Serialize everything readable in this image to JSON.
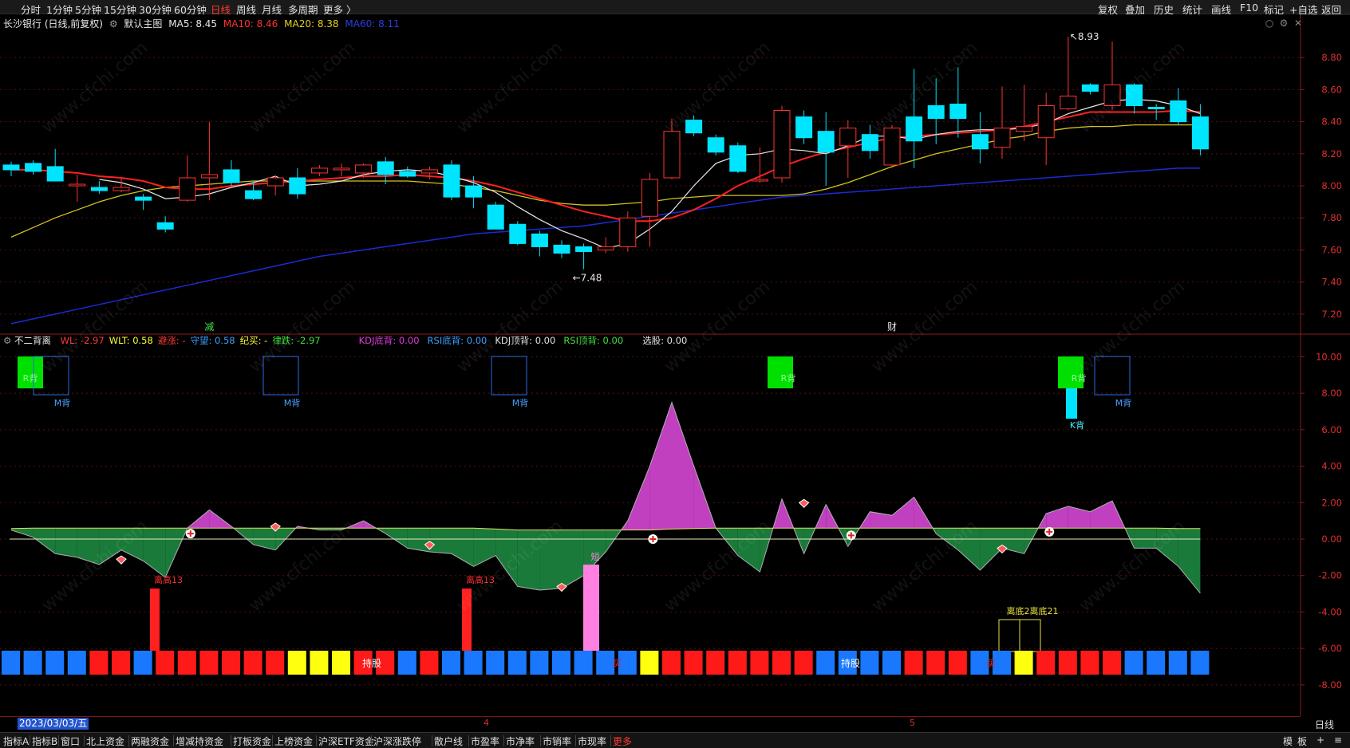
{
  "toolbar": {
    "periods": [
      "分时",
      "1分钟",
      "5分钟",
      "15分钟",
      "30分钟",
      "60分钟",
      "日线",
      "周线",
      "月线",
      "多周期",
      "更多 〉"
    ],
    "active_period": "日线",
    "right_items": [
      "复权",
      "叠加",
      "历史",
      "统计",
      "画线",
      "F10",
      "标记",
      "+自选",
      "返回"
    ]
  },
  "main_legend": {
    "security": "长沙银行 (日线,前复权)",
    "template": "默认主图",
    "ma5": "MA5: 8.45",
    "ma10": "MA10: 8.46",
    "ma20": "MA20: 8.38",
    "ma60": "MA60: 8.11"
  },
  "indicator_legend": {
    "name": "不二背离",
    "items": [
      {
        "text": "WL: -2.97",
        "color": "#ff3b3b"
      },
      {
        "text": "WLT: 0.58",
        "color": "#ffff30"
      },
      {
        "text": "避涨: -",
        "color": "#ff3b3b"
      },
      {
        "text": "守望: 0.58",
        "color": "#3aa0ff"
      },
      {
        "text": "纪买: -",
        "color": "#ffff30"
      },
      {
        "text": "律跌: -2.97",
        "color": "#40e040"
      },
      {
        "text": "KDJ底背: 0.00",
        "color": "#e040e0"
      },
      {
        "text": "RSI底背: 0.00",
        "color": "#3aa0ff"
      },
      {
        "text": "KDJ顶背: 0.00",
        "color": "#e0e0e0"
      },
      {
        "text": "RSI顶背: 0.00",
        "color": "#40e040"
      },
      {
        "text": "选股: 0.00",
        "color": "#e0e0e0"
      }
    ]
  },
  "price_axis": [
    "8.80",
    "8.60",
    "8.40",
    "8.20",
    "8.00",
    "7.80",
    "7.60",
    "7.40",
    "7.20"
  ],
  "ind_axis": [
    "10.00",
    "8.00",
    "6.00",
    "4.00",
    "2.00",
    "0.00",
    "-2.00",
    "-4.00",
    "-6.00",
    "-8.00"
  ],
  "annotations": {
    "high": "8.93",
    "low": "7.48",
    "event_a": "减",
    "event_b": "财",
    "r_back": "R背",
    "m_back": "M背",
    "k_back": "K背",
    "lili13": "离高13",
    "short": "短",
    "lidi21": "离底2离底21",
    "hold": "持股",
    "buy": "买"
  },
  "date_bar": {
    "cursor_date": "2023/03/03/五",
    "month_4": "4",
    "month_5": "5",
    "period_label": "日线"
  },
  "bottom_bar": {
    "items": [
      "指标A",
      "指标B",
      "窗口",
      "北上资金",
      "两融资金",
      "增减持资金",
      "打板资金",
      "上榜资金",
      "沪深ETF资金",
      "沪深涨跌停",
      "散户线",
      "市盈率",
      "市净率",
      "市销率",
      "市现率",
      "更多"
    ],
    "right": [
      "模",
      "板",
      "+",
      "≡"
    ]
  },
  "colors": {
    "up": "#ff3232",
    "down": "#00e5ff",
    "ma5": "#e8e8e8",
    "ma10": "#ff2020",
    "ma20": "#d4c21c",
    "ma60": "#1c2ad4",
    "magenta": "#c040c0",
    "green": "#1a7a3a"
  },
  "chart_data": {
    "type": "candlestick",
    "candles": [
      [
        8.13,
        8.1,
        8.15,
        8.06
      ],
      [
        8.14,
        8.09,
        8.16,
        8.07
      ],
      [
        8.12,
        8.03,
        8.23,
        8.03
      ],
      [
        8.0,
        8.01,
        8.07,
        7.9
      ],
      [
        7.99,
        7.97,
        8.03,
        7.95
      ],
      [
        7.97,
        7.99,
        8.05,
        7.96
      ],
      [
        7.93,
        7.91,
        7.95,
        7.85
      ],
      [
        7.77,
        7.73,
        7.81,
        7.71
      ],
      [
        7.91,
        8.05,
        8.19,
        7.9
      ],
      [
        8.05,
        8.07,
        8.4,
        7.91
      ],
      [
        8.1,
        8.02,
        8.16,
        8.0
      ],
      [
        7.97,
        7.92,
        8.03,
        7.91
      ],
      [
        8.0,
        8.05,
        8.06,
        7.94
      ],
      [
        8.05,
        7.95,
        8.11,
        7.92
      ],
      [
        8.08,
        8.11,
        8.13,
        8.06
      ],
      [
        8.1,
        8.11,
        8.14,
        8.06
      ],
      [
        8.08,
        8.13,
        8.14,
        8.05
      ],
      [
        8.15,
        8.07,
        8.18,
        8.01
      ],
      [
        8.09,
        8.06,
        8.12,
        8.05
      ],
      [
        8.08,
        8.1,
        8.12,
        8.04
      ],
      [
        8.13,
        7.93,
        8.16,
        7.91
      ],
      [
        8.0,
        7.93,
        8.06,
        7.86
      ],
      [
        7.88,
        7.73,
        7.9,
        7.73
      ],
      [
        7.76,
        7.64,
        7.78,
        7.63
      ],
      [
        7.7,
        7.62,
        7.72,
        7.56
      ],
      [
        7.63,
        7.58,
        7.66,
        7.55
      ],
      [
        7.62,
        7.59,
        7.64,
        7.48
      ],
      [
        7.6,
        7.62,
        7.68,
        7.58
      ],
      [
        7.62,
        7.8,
        7.84,
        7.59
      ],
      [
        7.81,
        8.04,
        8.08,
        7.62
      ],
      [
        8.05,
        8.34,
        8.42,
        8.04
      ],
      [
        8.41,
        8.33,
        8.44,
        8.31
      ],
      [
        8.3,
        8.21,
        8.32,
        8.19
      ],
      [
        8.25,
        8.09,
        8.27,
        8.08
      ],
      [
        8.03,
        8.04,
        8.24,
        8.02
      ],
      [
        8.05,
        8.47,
        8.5,
        8.02
      ],
      [
        8.43,
        8.3,
        8.47,
        8.26
      ],
      [
        8.34,
        8.21,
        8.46,
        8.0
      ],
      [
        8.25,
        8.36,
        8.41,
        8.05
      ],
      [
        8.32,
        8.22,
        8.38,
        8.17
      ],
      [
        8.13,
        8.36,
        8.38,
        8.11
      ],
      [
        8.43,
        8.28,
        8.73,
        8.11
      ],
      [
        8.5,
        8.42,
        8.67,
        8.26
      ],
      [
        8.51,
        8.42,
        8.74,
        8.3
      ],
      [
        8.32,
        8.23,
        8.46,
        8.14
      ],
      [
        8.24,
        8.36,
        8.62,
        8.17
      ],
      [
        8.34,
        8.37,
        8.63,
        8.28
      ],
      [
        8.3,
        8.5,
        8.58,
        8.13
      ],
      [
        8.48,
        8.56,
        8.93,
        8.47
      ],
      [
        8.63,
        8.59,
        8.64,
        8.57
      ],
      [
        8.5,
        8.63,
        8.9,
        8.47
      ],
      [
        8.63,
        8.5,
        8.64,
        8.45
      ],
      [
        8.49,
        8.48,
        8.51,
        8.41
      ],
      [
        8.53,
        8.4,
        8.61,
        8.38
      ],
      [
        8.43,
        8.23,
        8.51,
        8.19
      ]
    ],
    "ma5": [
      null,
      null,
      null,
      null,
      8.04,
      8.02,
      7.98,
      7.92,
      7.93,
      7.95,
      7.99,
      8.02,
      8.06,
      8.0,
      8.01,
      8.03,
      8.07,
      8.09,
      8.1,
      8.09,
      8.06,
      8.02,
      7.96,
      7.87,
      7.79,
      7.72,
      7.67,
      7.61,
      7.64,
      7.73,
      7.84,
      8.0,
      8.14,
      8.19,
      8.2,
      8.23,
      8.22,
      8.2,
      8.25,
      8.31,
      8.31,
      8.29,
      8.32,
      8.34,
      8.35,
      8.35,
      8.36,
      8.39,
      8.45,
      8.49,
      8.53,
      8.54,
      8.53,
      8.5,
      8.45
    ],
    "ma10": [
      8.1,
      8.1,
      8.09,
      8.08,
      8.06,
      8.05,
      8.03,
      7.99,
      7.98,
      7.98,
      8.0,
      8.01,
      8.02,
      8.03,
      8.04,
      8.05,
      8.06,
      8.06,
      8.07,
      8.06,
      8.05,
      8.03,
      8.0,
      7.96,
      7.92,
      7.88,
      7.84,
      7.81,
      7.78,
      7.78,
      7.8,
      7.85,
      7.92,
      8.0,
      8.06,
      8.12,
      8.17,
      8.21,
      8.24,
      8.27,
      8.3,
      8.31,
      8.32,
      8.33,
      8.34,
      8.35,
      8.37,
      8.4,
      8.43,
      8.46,
      8.46,
      8.46,
      8.46,
      8.47,
      8.46
    ],
    "ma20": [
      7.68,
      7.74,
      7.8,
      7.85,
      7.9,
      7.94,
      7.97,
      7.99,
      8.0,
      8.01,
      8.02,
      8.03,
      8.03,
      8.03,
      8.03,
      8.03,
      8.03,
      8.03,
      8.03,
      8.02,
      8.01,
      7.99,
      7.97,
      7.94,
      7.91,
      7.89,
      7.88,
      7.88,
      7.89,
      7.9,
      7.92,
      7.93,
      7.94,
      7.94,
      7.94,
      7.94,
      7.95,
      7.98,
      8.02,
      8.07,
      8.12,
      8.16,
      8.2,
      8.23,
      8.26,
      8.29,
      8.31,
      8.34,
      8.36,
      8.37,
      8.37,
      8.38,
      8.38,
      8.38,
      8.38
    ],
    "ma60": [
      7.14,
      7.17,
      7.2,
      7.23,
      7.26,
      7.29,
      7.32,
      7.35,
      7.38,
      7.41,
      7.44,
      7.47,
      7.5,
      7.53,
      7.56,
      7.58,
      7.6,
      7.62,
      7.64,
      7.66,
      7.68,
      7.7,
      7.71,
      7.72,
      7.73,
      7.74,
      7.75,
      7.77,
      7.79,
      7.81,
      7.83,
      7.85,
      7.87,
      7.89,
      7.91,
      7.93,
      7.94,
      7.95,
      7.96,
      7.97,
      7.98,
      7.99,
      8.0,
      8.01,
      8.02,
      8.03,
      8.04,
      8.05,
      8.06,
      8.07,
      8.08,
      8.09,
      8.1,
      8.11,
      8.11
    ],
    "price_range": [
      7.08,
      8.98
    ],
    "indicator": {
      "wl": [
        0.5,
        0.1,
        -0.8,
        -1.0,
        -1.4,
        -0.6,
        -1.2,
        -2.1,
        0.6,
        1.6,
        0.7,
        -0.3,
        -0.6,
        0.7,
        0.5,
        0.5,
        1.0,
        0.3,
        -0.5,
        -0.7,
        -0.8,
        -1.5,
        -0.9,
        -2.6,
        -2.8,
        -2.7,
        -2.0,
        -0.7,
        1.0,
        4.0,
        7.5,
        4.0,
        0.6,
        -0.9,
        -1.8,
        2.2,
        -0.8,
        1.9,
        -0.4,
        1.5,
        1.3,
        2.3,
        0.3,
        -0.6,
        -1.7,
        -0.5,
        -0.8,
        1.4,
        1.8,
        1.5,
        2.1,
        -0.5,
        -0.5,
        -1.5,
        -2.97
      ],
      "wlt": [
        0.58,
        0.6,
        0.6,
        0.6,
        0.6,
        0.6,
        0.6,
        0.6,
        0.6,
        0.6,
        0.6,
        0.6,
        0.6,
        0.6,
        0.6,
        0.6,
        0.6,
        0.6,
        0.6,
        0.6,
        0.6,
        0.6,
        0.55,
        0.5,
        0.5,
        0.5,
        0.5,
        0.5,
        0.5,
        0.5,
        0.55,
        0.58,
        0.6,
        0.6,
        0.6,
        0.6,
        0.6,
        0.6,
        0.6,
        0.6,
        0.6,
        0.6,
        0.6,
        0.6,
        0.6,
        0.6,
        0.6,
        0.6,
        0.6,
        0.6,
        0.6,
        0.6,
        0.6,
        0.58,
        0.58
      ],
      "range": [
        -10.5,
        10.5
      ]
    }
  }
}
